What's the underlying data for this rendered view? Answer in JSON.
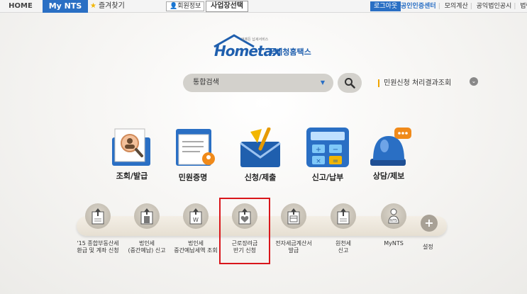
{
  "topbar": {
    "home": "HOME",
    "mynts": "My NTS",
    "favorites": "즐겨찾기",
    "member_info": "회원정보",
    "business_select": "사업장선택",
    "logout": "로그아웃",
    "links": [
      "공인인증센터",
      "모의계산",
      "공익법인공시",
      "법령정보"
    ]
  },
  "logo": {
    "tagline": "언제든 납세서비스",
    "brand": "Hometax",
    "korean": "국세청홈택스"
  },
  "search": {
    "selected": "통합검색",
    "result_link": "민원신청 처리결과조회"
  },
  "main_menu": [
    {
      "label": "조회/발급",
      "icon": "inquiry-icon"
    },
    {
      "label": "민원증명",
      "icon": "certificate-icon"
    },
    {
      "label": "신청/제출",
      "icon": "envelope-icon"
    },
    {
      "label": "신고/납부",
      "icon": "calculator-icon"
    },
    {
      "label": "상담/제보",
      "icon": "chat-light-icon"
    }
  ],
  "quick_menu": [
    {
      "label": "'15 종합부동산세\n환급 및 계좌 신청",
      "icon": "upload-doc-icon"
    },
    {
      "label": "법인세\n(중간예납) 신고",
      "icon": "building-doc-icon"
    },
    {
      "label": "법인세\n중간예납세액 조회",
      "icon": "won-doc-icon"
    },
    {
      "label": "근로장려금\n반기 신청",
      "icon": "heart-doc-icon"
    },
    {
      "label": "전자세금계산서\n발급",
      "icon": "invoice-doc-icon"
    },
    {
      "label": "원천세\n신고",
      "icon": "upload-doc-icon"
    },
    {
      "label": "MyNTS",
      "icon": "person-nts-icon"
    }
  ],
  "settings_label": "설정",
  "colors": {
    "accent": "#2a6fc4",
    "highlight": "#d9161b"
  }
}
